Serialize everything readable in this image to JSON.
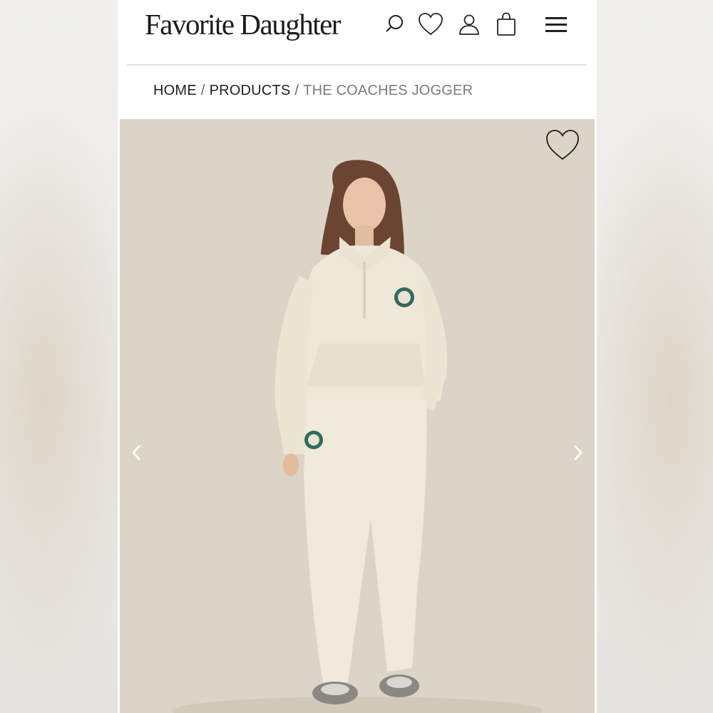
{
  "brand": {
    "logo_text": "Favorite Daughter"
  },
  "header": {
    "icons": [
      "search-icon",
      "heart-icon",
      "account-icon",
      "bag-icon",
      "menu-icon"
    ]
  },
  "breadcrumb": {
    "items": [
      {
        "label": "HOME"
      },
      {
        "label": "PRODUCTS"
      },
      {
        "label": "THE COACHES JOGGER"
      }
    ],
    "separator": "/"
  },
  "gallery": {
    "wishlist_icon": "heart-outline-icon",
    "prev_icon": "chevron-left-icon",
    "next_icon": "chevron-right-icon"
  },
  "colors": {
    "photo_background": "#ddd5c8",
    "garment_cream": "#efe9da",
    "crest_green": "#2f6b5a"
  }
}
